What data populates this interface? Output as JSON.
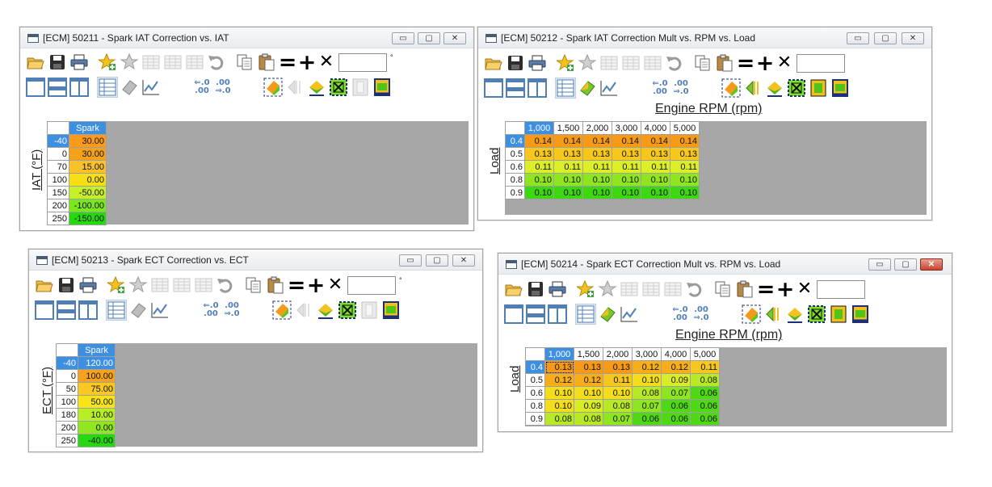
{
  "windows": [
    {
      "id": "w1",
      "title": "[ECM] 50211 - Spark IAT Correction vs. IAT",
      "controls": {
        "minimize": "▭",
        "maximize": "▢",
        "close": "✕"
      },
      "axis_vertical": "IAT (°F)",
      "col_header": "Spark",
      "rows": [
        {
          "label": "-40",
          "values": [
            "30.00"
          ]
        },
        {
          "label": "0",
          "values": [
            "30.00"
          ]
        },
        {
          "label": "70",
          "values": [
            "15.00"
          ]
        },
        {
          "label": "100",
          "values": [
            "0.00"
          ]
        },
        {
          "label": "150",
          "values": [
            "-50.00"
          ]
        },
        {
          "label": "200",
          "values": [
            "-100.00"
          ]
        },
        {
          "label": "250",
          "values": [
            "-150.00"
          ]
        }
      ],
      "cell_colors": [
        "#fb9a1c",
        "#f6a11a",
        "#fbc12a",
        "#f7df16",
        "#c5ef28",
        "#7ae61d",
        "#25d90f"
      ]
    },
    {
      "id": "w2",
      "title": "[ECM] 50212 - Spark IAT Correction Mult vs. RPM vs. Load",
      "controls": {
        "minimize": "▭",
        "maximize": "▢",
        "close": "✕"
      },
      "axis_horizontal": "Engine RPM (rpm)",
      "axis_vertical": "Load",
      "columns": [
        "1,000",
        "1,500",
        "2,000",
        "3,000",
        "4,000",
        "5,000"
      ],
      "rows": [
        {
          "label": "0.4",
          "values": [
            "0.14",
            "0.14",
            "0.14",
            "0.14",
            "0.14",
            "0.14"
          ]
        },
        {
          "label": "0.5",
          "values": [
            "0.13",
            "0.13",
            "0.13",
            "0.13",
            "0.13",
            "0.13"
          ]
        },
        {
          "label": "0.6",
          "values": [
            "0.11",
            "0.11",
            "0.11",
            "0.11",
            "0.11",
            "0.11"
          ]
        },
        {
          "label": "0.8",
          "values": [
            "0.10",
            "0.10",
            "0.10",
            "0.10",
            "0.10",
            "0.10"
          ]
        },
        {
          "label": "0.9",
          "values": [
            "0.10",
            "0.10",
            "0.10",
            "0.10",
            "0.10",
            "0.10"
          ]
        }
      ],
      "row_colors": [
        "#f79a18",
        "#f8c71d",
        "#dcee27",
        "#8fe620",
        "#3ed812"
      ]
    },
    {
      "id": "w3",
      "title": "[ECM] 50213 - Spark ECT Correction vs. ECT",
      "controls": {
        "minimize": "▭",
        "maximize": "▢",
        "close": "✕"
      },
      "axis_vertical": "ECT (°F)",
      "col_header": "Spark",
      "rows": [
        {
          "label": "-40",
          "values": [
            "120.00"
          ]
        },
        {
          "label": "0",
          "values": [
            "100.00"
          ]
        },
        {
          "label": "50",
          "values": [
            "75.00"
          ]
        },
        {
          "label": "100",
          "values": [
            "50.00"
          ]
        },
        {
          "label": "180",
          "values": [
            "10.00"
          ]
        },
        {
          "label": "200",
          "values": [
            "0.00"
          ]
        },
        {
          "label": "250",
          "values": [
            "-40.00"
          ]
        }
      ],
      "cell_colors": [
        "#3d8fe2",
        "#f7a21b",
        "#f9c922",
        "#f8e319",
        "#b7ee26",
        "#90e71f",
        "#25d90f"
      ]
    },
    {
      "id": "w4",
      "title": "[ECM] 50214 - Spark ECT Correction Mult vs. RPM vs. Load",
      "controls": {
        "minimize": "▭",
        "maximize": "▢",
        "close": "✕"
      },
      "axis_horizontal": "Engine RPM (rpm)",
      "axis_vertical": "Load",
      "columns": [
        "1,000",
        "1,500",
        "2,000",
        "3,000",
        "4,000",
        "5,000"
      ],
      "rows": [
        {
          "label": "0.4",
          "values": [
            "0.13",
            "0.13",
            "0.13",
            "0.12",
            "0.12",
            "0.11"
          ]
        },
        {
          "label": "0.5",
          "values": [
            "0.12",
            "0.12",
            "0.11",
            "0.10",
            "0.09",
            "0.08"
          ]
        },
        {
          "label": "0.6",
          "values": [
            "0.10",
            "0.10",
            "0.10",
            "0.08",
            "0.07",
            "0.06"
          ]
        },
        {
          "label": "0.8",
          "values": [
            "0.10",
            "0.09",
            "0.08",
            "0.07",
            "0.06",
            "0.06"
          ]
        },
        {
          "label": "0.9",
          "values": [
            "0.08",
            "0.08",
            "0.07",
            "0.06",
            "0.06",
            "0.06"
          ]
        }
      ],
      "cell_colors": [
        [
          "#f79a18",
          "#f79a18",
          "#f79a18",
          "#f8ad1a",
          "#f8ad1a",
          "#f8c71d"
        ],
        [
          "#f8ad1a",
          "#f8ad1a",
          "#f8c71d",
          "#f4dd1a",
          "#d8ed26",
          "#b7ea24"
        ],
        [
          "#f4dd1a",
          "#f4dd1a",
          "#f4dd1a",
          "#b7ea24",
          "#8fe620",
          "#4fd914"
        ],
        [
          "#f4dd1a",
          "#d8ed26",
          "#b7ea24",
          "#8fe620",
          "#4fd914",
          "#4fd914"
        ],
        [
          "#b7ea24",
          "#b7ea24",
          "#8fe620",
          "#4fd914",
          "#4fd914",
          "#4fd914"
        ]
      ]
    }
  ],
  "toolbar_icons": {
    "row1": [
      "open-folder-icon",
      "save-icon",
      "print-icon",
      "favorite-add-icon",
      "favorite-icon",
      "table-icon",
      "table-icon",
      "table-icon",
      "undo-icon",
      "copy-icon",
      "paste-icon",
      "set-equal-icon",
      "add-icon",
      "multiply-icon"
    ],
    "row2": [
      "single-view-icon",
      "split-horizontal-icon",
      "split-vertical-icon",
      "table-view-icon",
      "3d-surface-icon",
      "graph-icon",
      "decimal-decrease-icon",
      "decimal-increase-icon",
      "color-map-icon",
      "color-select-icon",
      "smooth-icon",
      "interpolate-icon",
      "fill-icon",
      "highlight-icon"
    ]
  },
  "colors": {
    "selection": "#3d8fe2",
    "panel": "#a7a7a7"
  }
}
